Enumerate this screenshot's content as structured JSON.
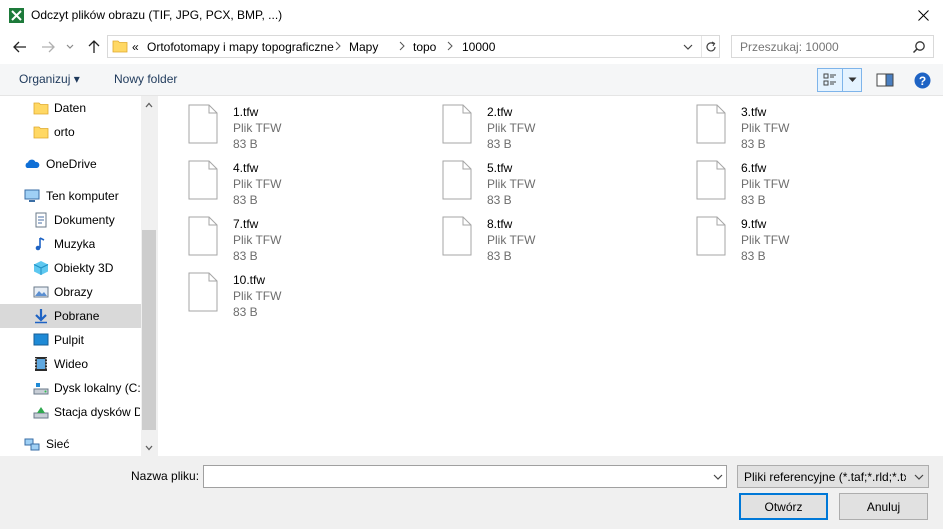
{
  "window": {
    "title": "Odczyt plików obrazu (TIF, JPG, PCX, BMP, ...)"
  },
  "address": {
    "overflow": "«",
    "crumbs": [
      "Ortofotomapy i mapy topograficzne",
      "Mapy",
      "topo",
      "10000"
    ]
  },
  "search": {
    "placeholder": "Przeszukaj: 10000"
  },
  "toolbar": {
    "organize": "Organizuj ▾",
    "new_folder": "Nowy folder"
  },
  "sidebar": {
    "items": [
      {
        "label": "Daten",
        "icon": "folder-icon"
      },
      {
        "label": "orto",
        "icon": "folder-icon"
      },
      {
        "label": "OneDrive",
        "icon": "cloud-icon"
      },
      {
        "label": "Ten komputer",
        "icon": "computer-icon"
      },
      {
        "label": "Dokumenty",
        "icon": "documents-icon"
      },
      {
        "label": "Muzyka",
        "icon": "music-icon"
      },
      {
        "label": "Obiekty 3D",
        "icon": "cube-icon"
      },
      {
        "label": "Obrazy",
        "icon": "pictures-icon"
      },
      {
        "label": "Pobrane",
        "icon": "download-icon"
      },
      {
        "label": "Pulpit",
        "icon": "desktop-icon"
      },
      {
        "label": "Wideo",
        "icon": "video-icon"
      },
      {
        "label": "Dysk lokalny (C:)",
        "icon": "drive-icon"
      },
      {
        "label": "Stacja dysków D",
        "icon": "disc-drive-icon"
      },
      {
        "label": "Sieć",
        "icon": "network-icon"
      }
    ]
  },
  "files": [
    {
      "name": "1.tfw",
      "type": "Plik TFW",
      "size": "83 B"
    },
    {
      "name": "2.tfw",
      "type": "Plik TFW",
      "size": "83 B"
    },
    {
      "name": "3.tfw",
      "type": "Plik TFW",
      "size": "83 B"
    },
    {
      "name": "4.tfw",
      "type": "Plik TFW",
      "size": "83 B"
    },
    {
      "name": "5.tfw",
      "type": "Plik TFW",
      "size": "83 B"
    },
    {
      "name": "6.tfw",
      "type": "Plik TFW",
      "size": "83 B"
    },
    {
      "name": "7.tfw",
      "type": "Plik TFW",
      "size": "83 B"
    },
    {
      "name": "8.tfw",
      "type": "Plik TFW",
      "size": "83 B"
    },
    {
      "name": "9.tfw",
      "type": "Plik TFW",
      "size": "83 B"
    },
    {
      "name": "10.tfw",
      "type": "Plik TFW",
      "size": "83 B"
    }
  ],
  "footer": {
    "filename_label": "Nazwa pliku:",
    "filename_value": "",
    "filter": "Pliki referencyjne (*.taf;*.rld;*.tx",
    "open": "Otwórz",
    "cancel": "Anuluj"
  },
  "colors": {
    "accent": "#0078d7",
    "selected": "#d9d9d9",
    "command_text": "#1e395b"
  }
}
